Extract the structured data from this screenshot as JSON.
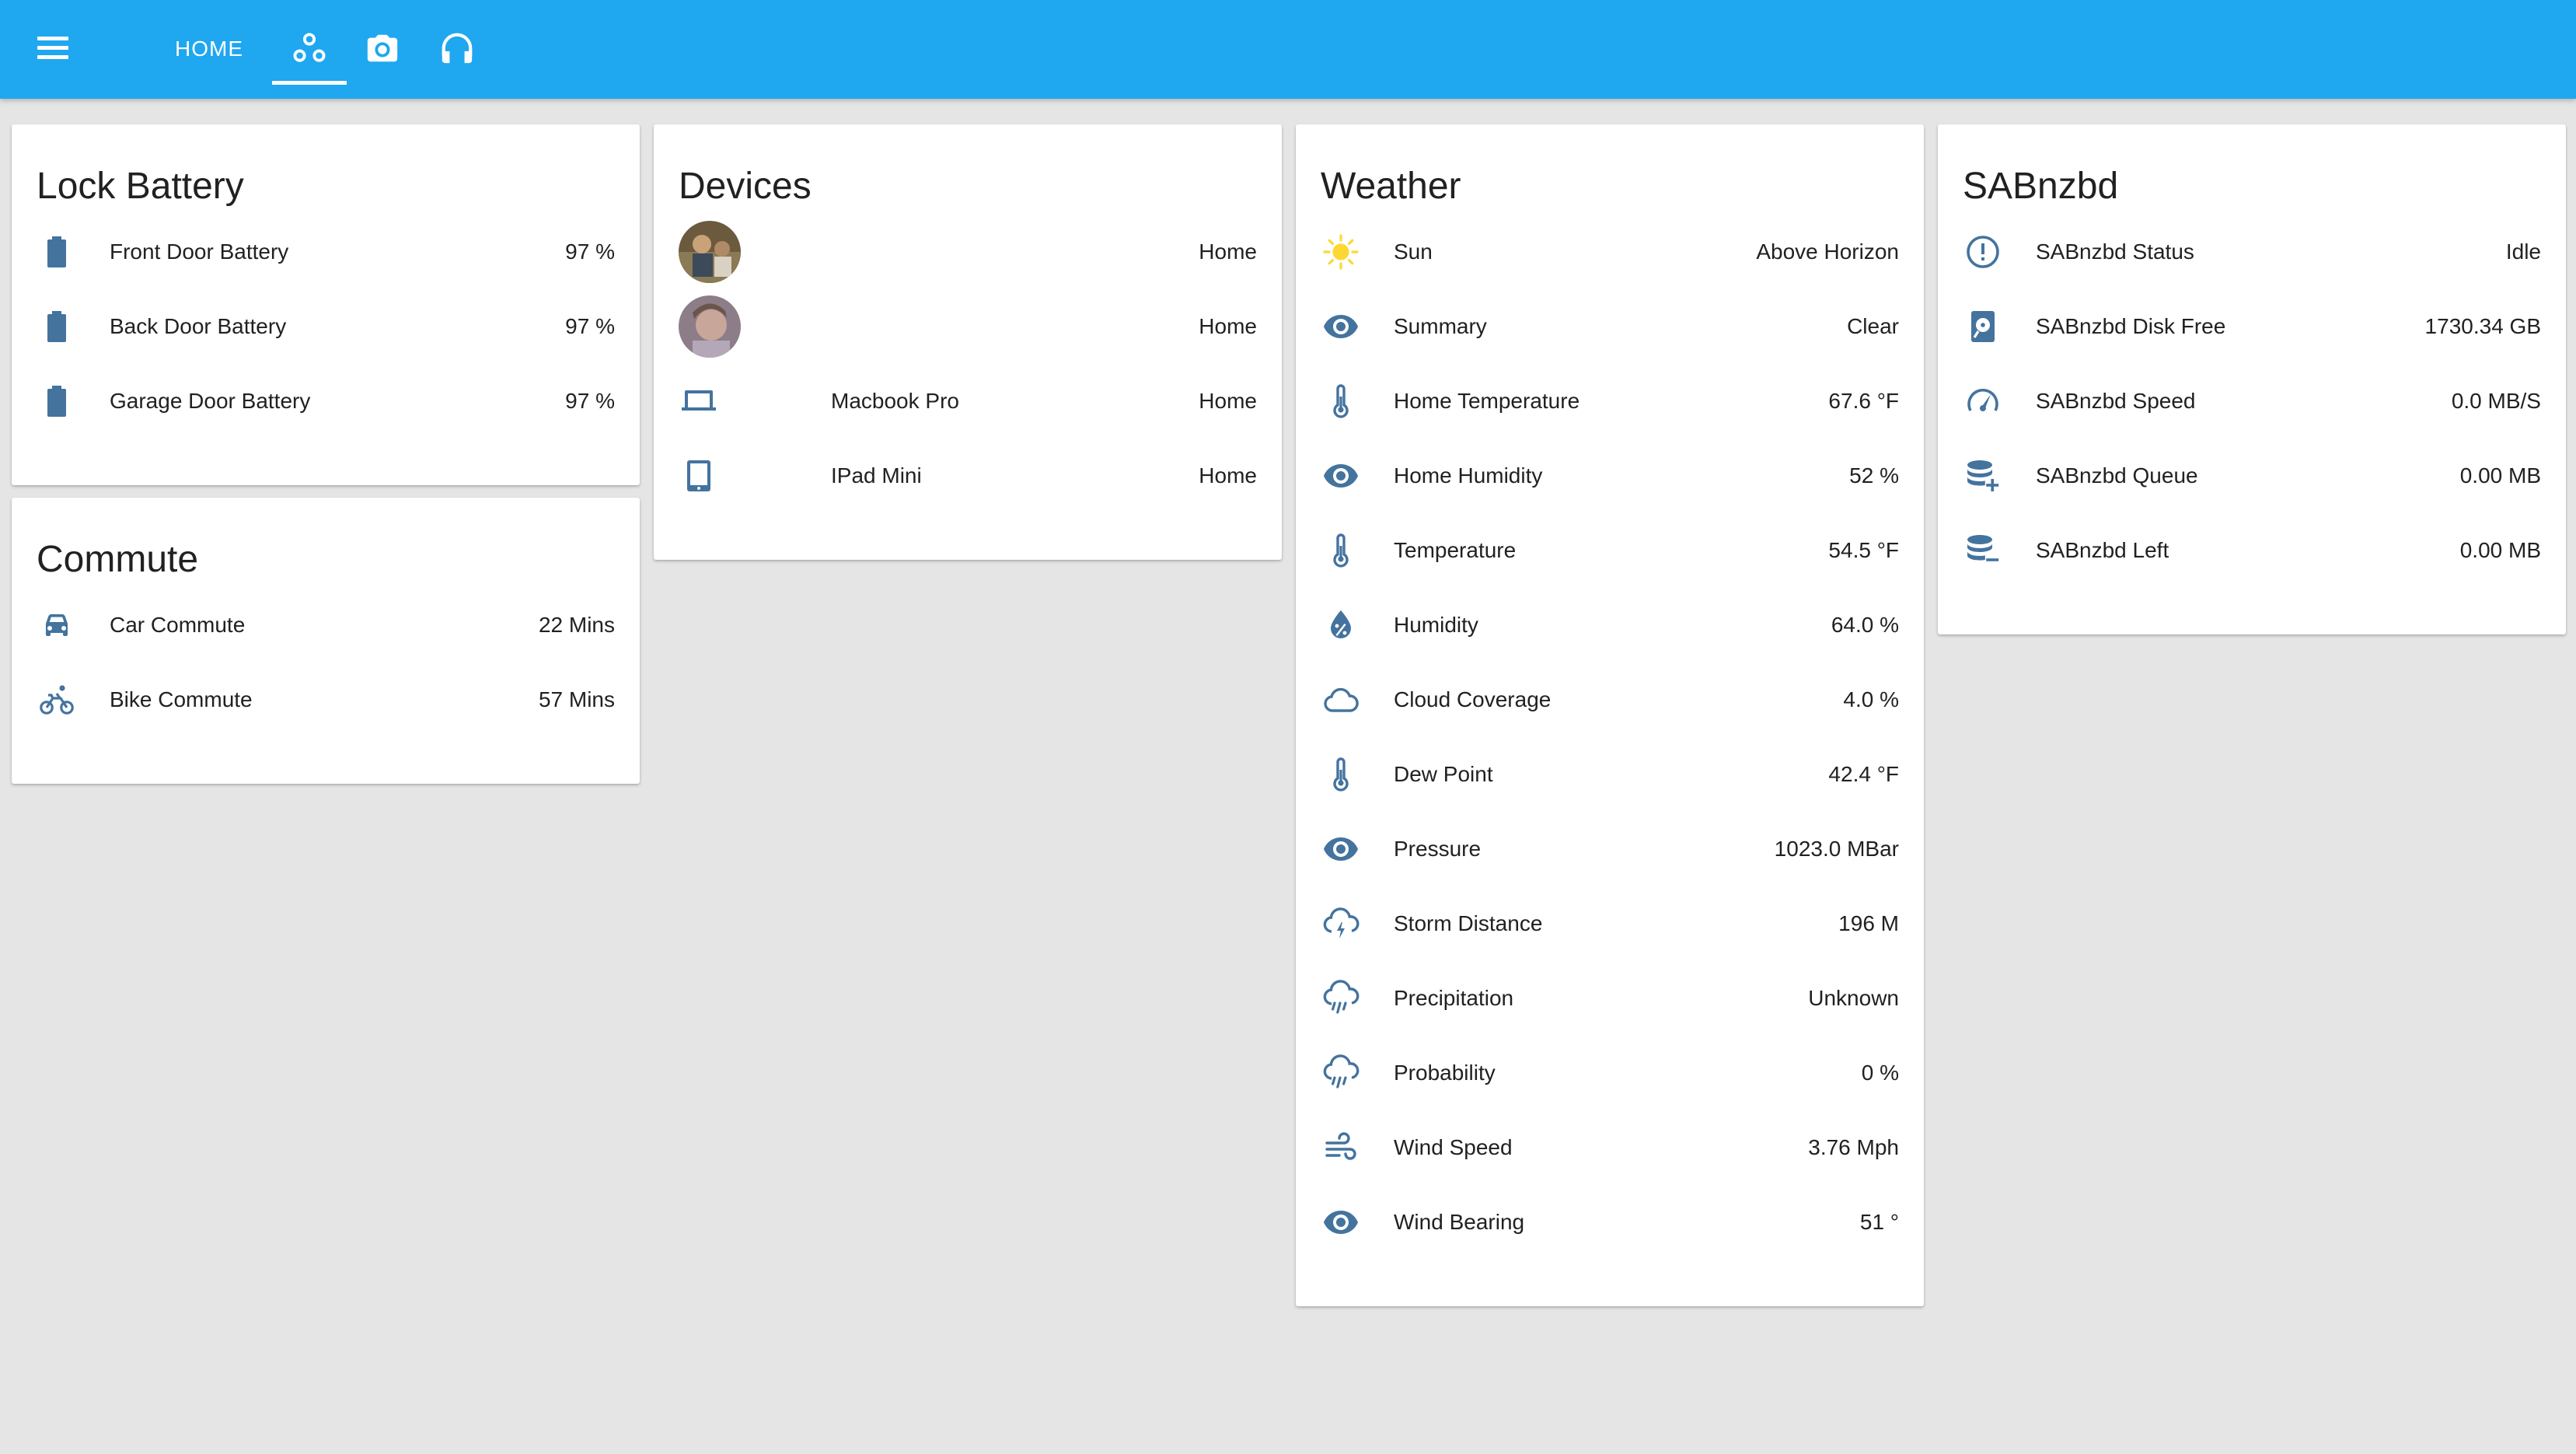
{
  "header": {
    "menu_icon": "menu-icon",
    "tabs": [
      {
        "label": "HOME"
      },
      {
        "icon": "account-group-icon",
        "active": true
      },
      {
        "icon": "camera-icon"
      },
      {
        "icon": "headphones-icon"
      }
    ],
    "background": "#1fa7f0"
  },
  "colors": {
    "icon": "#44739e",
    "sun": "#fdd835",
    "background": "#e5e5e5"
  },
  "lock_battery": {
    "title": "Lock Battery",
    "rows": [
      {
        "icon": "battery-icon",
        "label": "Front Door Battery",
        "value": "97 %"
      },
      {
        "icon": "battery-icon",
        "label": "Back Door Battery",
        "value": "97 %"
      },
      {
        "icon": "battery-icon",
        "label": "Garage Door Battery",
        "value": "97 %"
      }
    ]
  },
  "commute": {
    "title": "Commute",
    "rows": [
      {
        "icon": "car-icon",
        "label": "Car Commute",
        "value": "22 Mins"
      },
      {
        "icon": "bike-icon",
        "label": "Bike Commute",
        "value": "57 Mins"
      }
    ]
  },
  "devices": {
    "title": "Devices",
    "rows": [
      {
        "icon": "avatar-photo",
        "label": "",
        "value": "Home"
      },
      {
        "icon": "avatar-photo",
        "label": "",
        "value": "Home"
      },
      {
        "icon": "laptop-icon",
        "label": "Macbook Pro",
        "value": "Home"
      },
      {
        "icon": "tablet-icon",
        "label": "IPad Mini",
        "value": "Home"
      }
    ]
  },
  "weather": {
    "title": "Weather",
    "rows": [
      {
        "icon": "sun-icon",
        "label": "Sun",
        "value": "Above Horizon"
      },
      {
        "icon": "eye-icon",
        "label": "Summary",
        "value": "Clear"
      },
      {
        "icon": "thermometer-icon",
        "label": "Home Temperature",
        "value": "67.6 °F"
      },
      {
        "icon": "eye-icon",
        "label": "Home Humidity",
        "value": "52 %"
      },
      {
        "icon": "thermometer-icon",
        "label": "Temperature",
        "value": "54.5 °F"
      },
      {
        "icon": "water-percent-icon",
        "label": "Humidity",
        "value": "64.0 %"
      },
      {
        "icon": "cloud-icon",
        "label": "Cloud Coverage",
        "value": "4.0 %"
      },
      {
        "icon": "thermometer-icon",
        "label": "Dew Point",
        "value": "42.4 °F"
      },
      {
        "icon": "eye-icon",
        "label": "Pressure",
        "value": "1023.0 MBar"
      },
      {
        "icon": "lightning-cloud-icon",
        "label": "Storm Distance",
        "value": "196 M"
      },
      {
        "icon": "rain-cloud-icon",
        "label": "Precipitation",
        "value": "Unknown"
      },
      {
        "icon": "rain-cloud-icon",
        "label": "Probability",
        "value": "0 %"
      },
      {
        "icon": "wind-icon",
        "label": "Wind Speed",
        "value": "3.76 Mph"
      },
      {
        "icon": "eye-icon",
        "label": "Wind Bearing",
        "value": "51 °"
      }
    ]
  },
  "sabnzbd": {
    "title": "SABnzbd",
    "rows": [
      {
        "icon": "alert-circle-icon",
        "label": "SABnzbd Status",
        "value": "Idle"
      },
      {
        "icon": "harddisk-icon",
        "label": "SABnzbd Disk Free",
        "value": "1730.34 GB"
      },
      {
        "icon": "speedometer-icon",
        "label": "SABnzbd Speed",
        "value": "0.0 MB/S"
      },
      {
        "icon": "database-plus-icon",
        "label": "SABnzbd Queue",
        "value": "0.00 MB"
      },
      {
        "icon": "database-minus-icon",
        "label": "SABnzbd Left",
        "value": "0.00 MB"
      }
    ]
  }
}
